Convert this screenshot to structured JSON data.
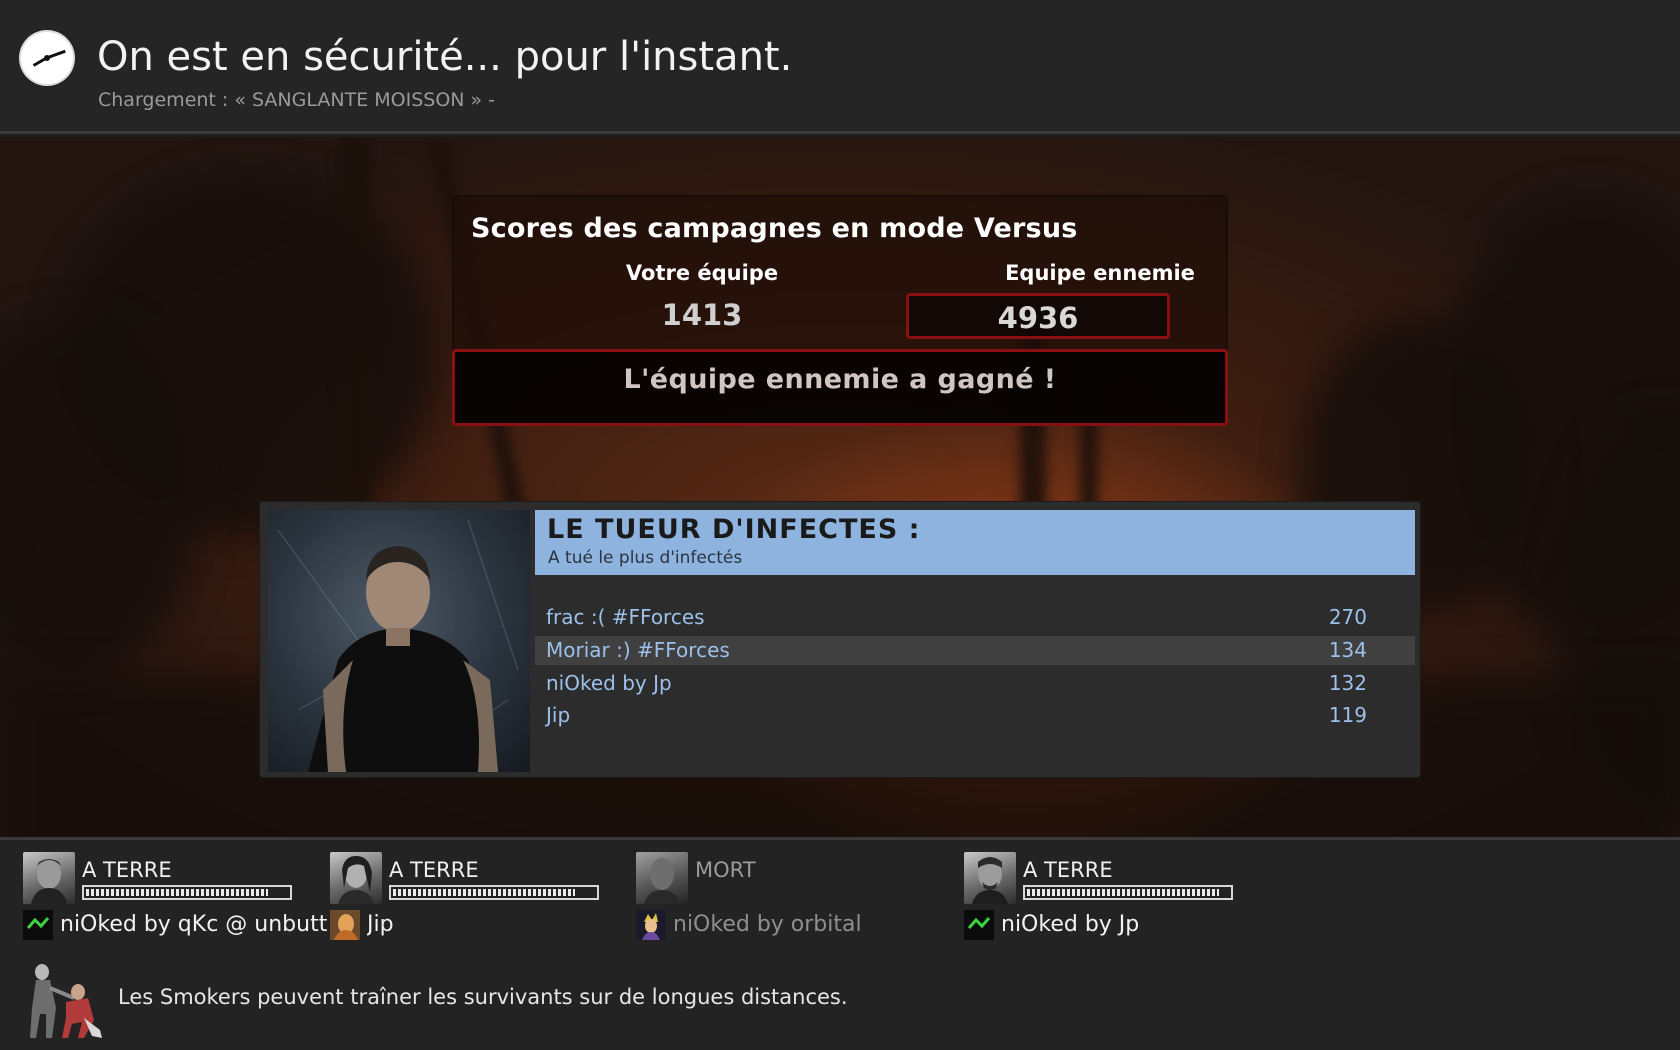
{
  "header": {
    "title": "On est en sécurité... pour l'instant.",
    "subtitle": "Chargement : « SANGLANTE MOISSON » -",
    "icon": "clock-icon"
  },
  "versus": {
    "title": "Scores des campagnes en mode Versus",
    "your_team_label": "Votre équipe",
    "your_team_score": "1413",
    "enemy_team_label": "Equipe ennemie",
    "enemy_team_score": "4936",
    "result": "L'équipe ennemie a gagné !",
    "accent_color": "#8a0f12"
  },
  "award": {
    "title": "LE TUEUR D'INFECTES :",
    "subtitle": "A tué le plus d'infectés",
    "header_color": "#8db3de",
    "entries": [
      {
        "name": "frac :( #FForces",
        "value": "270"
      },
      {
        "name": "Moriar :) #FForces",
        "value": "134"
      },
      {
        "name": "niOked by Jp",
        "value": "132"
      },
      {
        "name": "Jip",
        "value": "119"
      }
    ]
  },
  "players": [
    {
      "status": "A TERRE",
      "name": "niOked by qKc @ unbutto",
      "health": 0.9
    },
    {
      "status": "A TERRE",
      "name": "Jip",
      "health": 0.9
    },
    {
      "status": "MORT",
      "name": "niOked by orbital",
      "health": 0
    },
    {
      "status": "A TERRE",
      "name": "niOked by Jp",
      "health": 0.95
    }
  ],
  "tip": {
    "text": "Les Smokers peuvent traîner les survivants sur de longues distances.",
    "icon": "smoker-icon"
  }
}
